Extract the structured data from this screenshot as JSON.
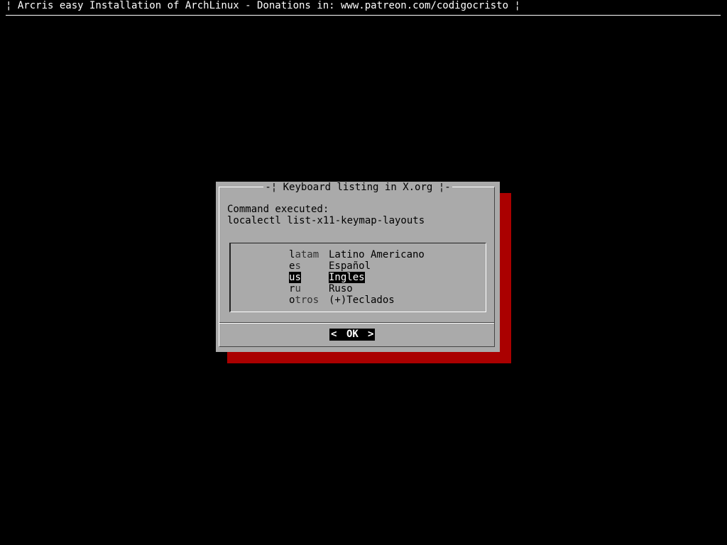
{
  "window": {
    "title": "¦ Arcris easy Installation of ArchLinux - Donations in: www.patreon.com/codigocristo ¦"
  },
  "dialog": {
    "title": "-¦ Keyboard listing in X.org ¦-",
    "line1": "Command executed:",
    "line2": "localectl list-x11-keymap-layouts",
    "menu": {
      "items": [
        {
          "tag_hot": "l",
          "tag_rest": "atam",
          "desc": "Latino Americano",
          "selected": false
        },
        {
          "tag_hot": "e",
          "tag_rest": "s",
          "desc": "Español",
          "selected": false
        },
        {
          "tag_hot": "u",
          "tag_rest": "s",
          "desc": "Ingles",
          "selected": true
        },
        {
          "tag_hot": "r",
          "tag_rest": "u",
          "desc": "Ruso",
          "selected": false
        },
        {
          "tag_hot": "o",
          "tag_rest": "tros",
          "desc": "(+)Teclados",
          "selected": false
        }
      ]
    },
    "ok_button": {
      "left_glyph": "<",
      "label": "OK",
      "right_glyph": ">"
    }
  },
  "colors": {
    "background": "#000000",
    "dialog": "#aaaaaa",
    "shadow": "#aa0000",
    "selection": "#000000"
  }
}
